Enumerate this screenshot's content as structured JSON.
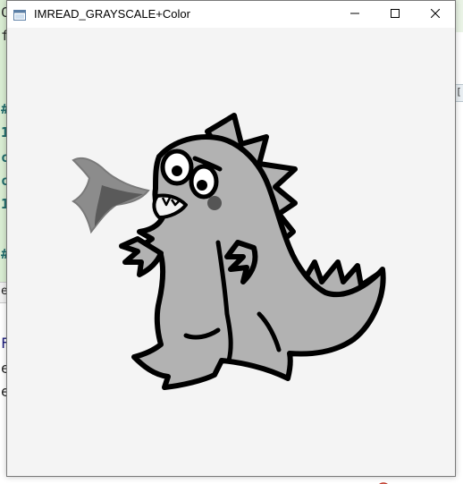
{
  "window": {
    "title": "IMREAD_GRAYSCALE+Color",
    "buttons": {
      "minimize_icon": "minimize-icon",
      "maximize_icon": "maximize-icon",
      "close_icon": "close-icon"
    }
  },
  "image": {
    "subject": "gray cartoon dinosaur breathing fire",
    "palette": {
      "background": "#f4f4f4",
      "body": "#b2b2b2",
      "outline": "#000000",
      "fire_outer": "#8c8c8c",
      "fire_inner": "#5a5a5a",
      "cheek": "#555555"
    }
  },
  "background_app": {
    "left_chars": [
      "C",
      "f",
      "#",
      "1",
      "c",
      "c",
      "1",
      "#",
      "e",
      "F",
      "e",
      "e"
    ],
    "right_chars": [
      "["
    ],
    "colors": {
      "editor_green": "#d9ecd2",
      "keyword_teal": "#1f6b6b"
    }
  }
}
